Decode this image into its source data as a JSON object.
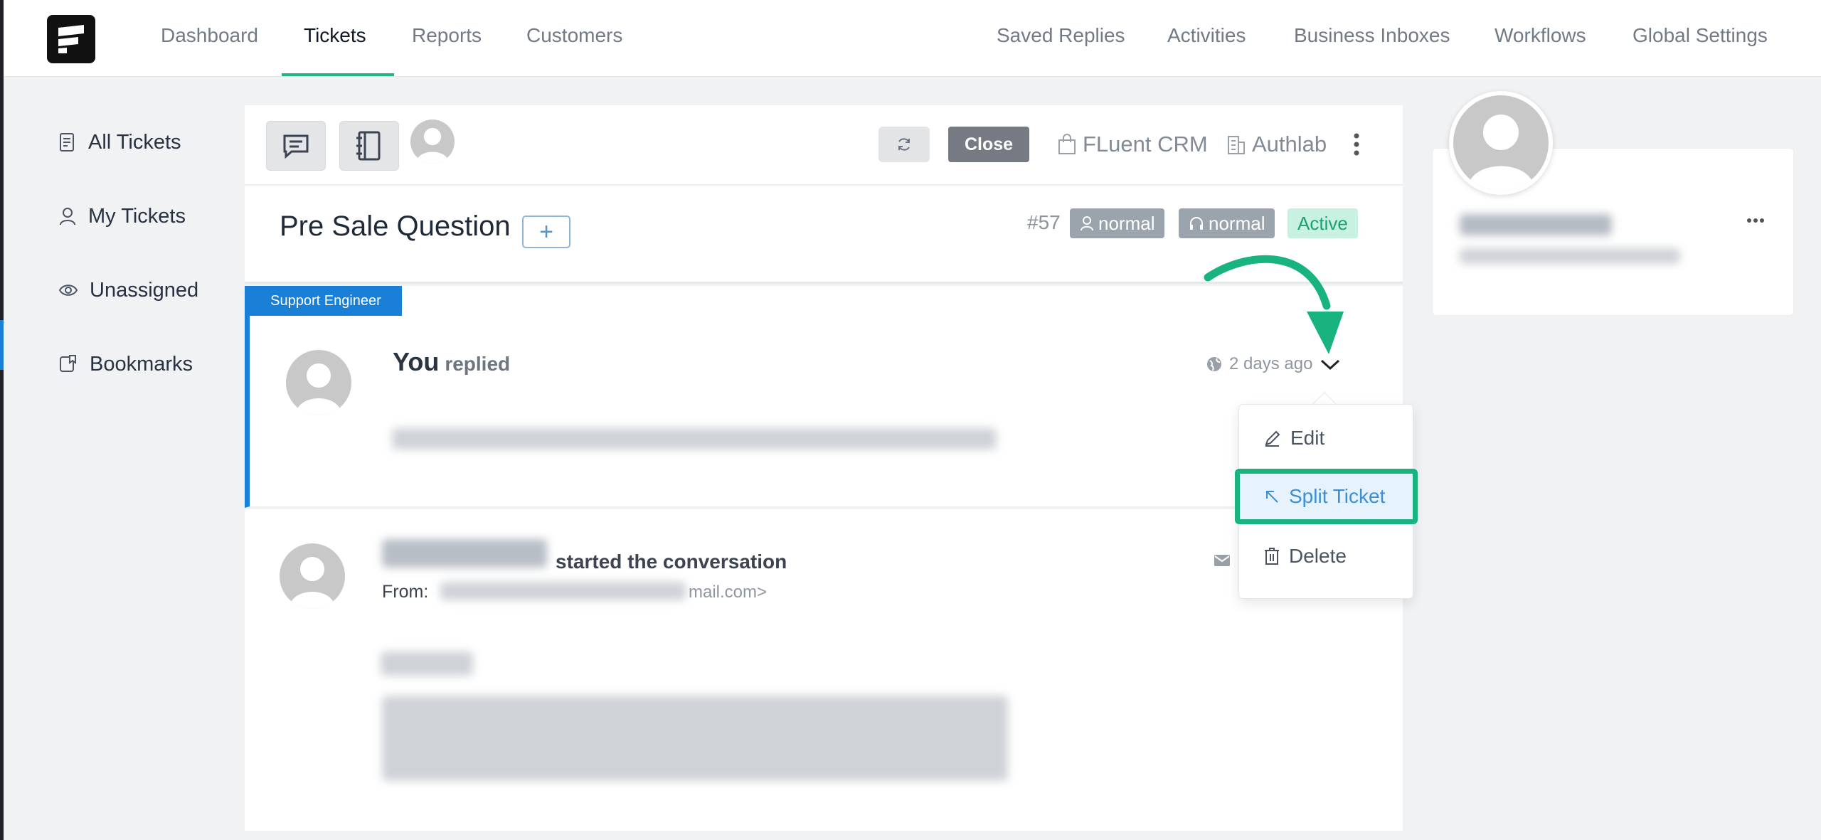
{
  "nav": {
    "left": [
      "Dashboard",
      "Tickets",
      "Reports",
      "Customers"
    ],
    "right": [
      "Saved Replies",
      "Activities",
      "Business Inboxes",
      "Workflows",
      "Global Settings"
    ],
    "active": "Tickets"
  },
  "sidebar": {
    "items": [
      {
        "label": "All Tickets",
        "icon": "document-icon"
      },
      {
        "label": "My Tickets",
        "icon": "user-icon"
      },
      {
        "label": "Unassigned",
        "icon": "eye-icon"
      },
      {
        "label": "Bookmarks",
        "icon": "bookmark-icon"
      }
    ]
  },
  "toolbar": {
    "close_label": "Close",
    "product_label": "FLuent CRM",
    "company_label": "Authlab"
  },
  "ticket": {
    "title": "Pre Sale Question",
    "add_label": "+",
    "number": "#57",
    "tag_client_priority": "normal",
    "tag_agent_priority": "normal",
    "status": "Active"
  },
  "reply": {
    "role": "Support Engineer",
    "author": "You",
    "verb": "replied",
    "time": "2 days ago"
  },
  "conversation": {
    "verb": "started the conversation",
    "from_label": "From:",
    "email_tail": "mail.com>"
  },
  "menu": {
    "edit": "Edit",
    "split": "Split Ticket",
    "delete": "Delete"
  },
  "colors": {
    "accent_green": "#18b37e",
    "accent_blue": "#1a7fd6",
    "status_active_bg": "#c8f1e2"
  }
}
